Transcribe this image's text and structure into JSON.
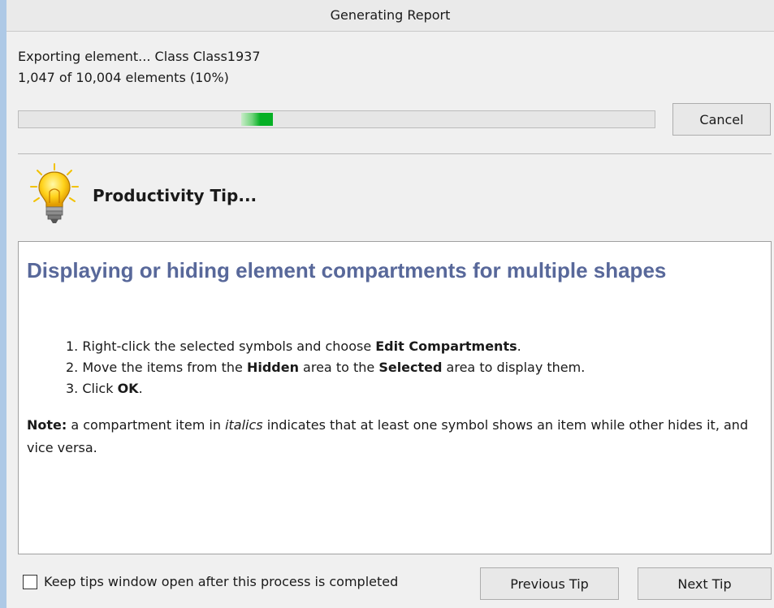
{
  "window": {
    "title": "Generating Report"
  },
  "status": {
    "line1": "Exporting element... Class Class1937",
    "line2": "1,047 of 10,004 elements (10%)",
    "progress_fraction": 0.1
  },
  "buttons": {
    "cancel": "Cancel",
    "previous_tip": "Previous Tip",
    "next_tip": "Next Tip"
  },
  "tip": {
    "header": "Productivity Tip...",
    "icon": "lightbulb-icon",
    "title": "Displaying or hiding element compartments for multiple shapes",
    "steps": [
      {
        "num": "1.",
        "pre": "Right-click the selected symbols and choose ",
        "bold1": "Edit Compartments",
        "post": "."
      },
      {
        "num": "2.",
        "pre": "Move the items from the ",
        "bold1": "Hidden",
        "mid": " area to the ",
        "bold2": "Selected",
        "post": " area to display them."
      },
      {
        "num": "3.",
        "pre": "Click ",
        "bold1": "OK",
        "post": "."
      }
    ],
    "note": {
      "label": "Note:",
      "pre": " a compartment item in ",
      "italic": "italics",
      "post": " indicates that at least one symbol shows an item while other hides it, and vice versa."
    }
  },
  "footer": {
    "checkbox_label": "Keep tips window open after this process is completed",
    "checkbox_checked": false
  },
  "colors": {
    "heading": "#58689a",
    "progress": "#06b025",
    "window_border": "#aec9e6"
  }
}
